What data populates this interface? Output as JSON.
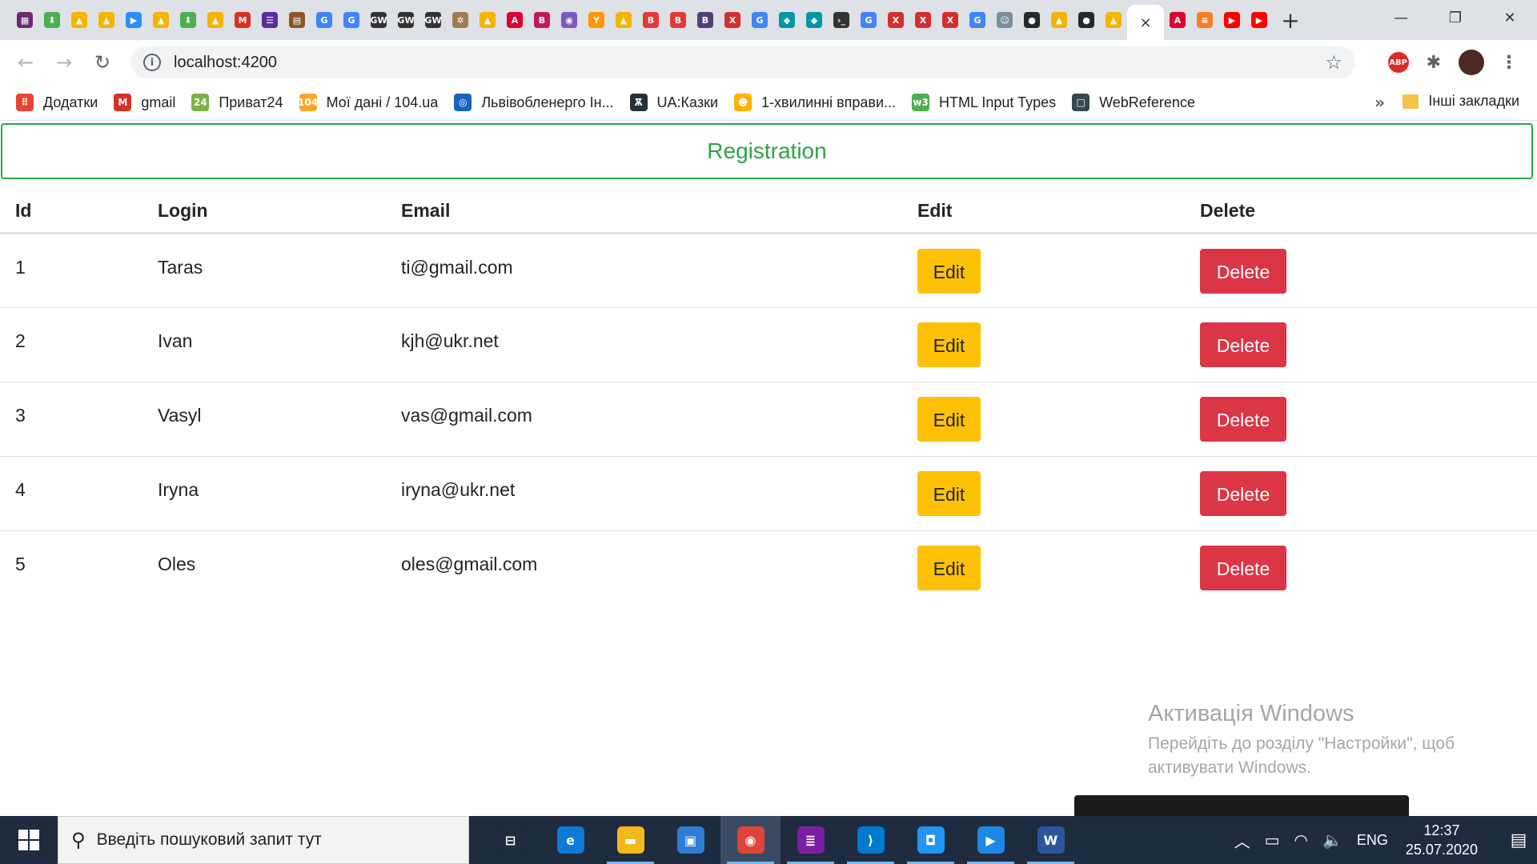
{
  "browser": {
    "tabs": [
      {
        "icon": "calendar-grid-icon",
        "color": "#6a2c70",
        "glyph": "▦"
      },
      {
        "icon": "download-arrow-icon",
        "color": "#4caf50",
        "glyph": "⬇"
      },
      {
        "icon": "google-drive-icon",
        "color": "#f4b400",
        "glyph": "▲"
      },
      {
        "icon": "google-drive-icon",
        "color": "#f4b400",
        "glyph": "▲"
      },
      {
        "icon": "zoom-icon",
        "color": "#2d8cff",
        "glyph": "▶"
      },
      {
        "icon": "google-drive-icon",
        "color": "#f4b400",
        "glyph": "▲"
      },
      {
        "icon": "download-arrow-icon",
        "color": "#4caf50",
        "glyph": "⬇"
      },
      {
        "icon": "google-drive-icon",
        "color": "#f4b400",
        "glyph": "▲"
      },
      {
        "icon": "gmail-icon",
        "color": "#d93025",
        "glyph": "M"
      },
      {
        "icon": "list-icon",
        "color": "#5b2c9a",
        "glyph": "☰"
      },
      {
        "icon": "image-icon",
        "color": "#8d5524",
        "glyph": "▤"
      },
      {
        "icon": "translate-icon",
        "color": "#4285f4",
        "glyph": "G"
      },
      {
        "icon": "translate-icon",
        "color": "#4285f4",
        "glyph": "G"
      },
      {
        "icon": "gw-icon",
        "color": "#333333",
        "glyph": "GW"
      },
      {
        "icon": "gw-icon",
        "color": "#333333",
        "glyph": "GW"
      },
      {
        "icon": "gw-icon",
        "color": "#333333",
        "glyph": "GW"
      },
      {
        "icon": "tree-icon",
        "color": "#9e7b4f",
        "glyph": "✲"
      },
      {
        "icon": "google-drive-icon",
        "color": "#f4b400",
        "glyph": "▲"
      },
      {
        "icon": "angular-icon",
        "color": "#dd0031",
        "glyph": "A"
      },
      {
        "icon": "b-icon",
        "color": "#c2185b",
        "glyph": "B"
      },
      {
        "icon": "eye-icon",
        "color": "#7e57c2",
        "glyph": "◉"
      },
      {
        "icon": "figure-icon",
        "color": "#ff9800",
        "glyph": "Y"
      },
      {
        "icon": "google-drive-icon",
        "color": "#f4b400",
        "glyph": "▲"
      },
      {
        "icon": "b-icon",
        "color": "#e53935",
        "glyph": "B"
      },
      {
        "icon": "b-icon",
        "color": "#e53935",
        "glyph": "B"
      },
      {
        "icon": "bootstrap-icon",
        "color": "#563d7c",
        "glyph": "B"
      },
      {
        "icon": "figure-icon",
        "color": "#d32f2f",
        "glyph": "X"
      },
      {
        "icon": "google-icon",
        "color": "#4285f4",
        "glyph": "G"
      },
      {
        "icon": "bird-icon",
        "color": "#0097a7",
        "glyph": "◆"
      },
      {
        "icon": "bird-icon",
        "color": "#0097a7",
        "glyph": "◆"
      },
      {
        "icon": "terminal-icon",
        "color": "#333333",
        "glyph": "›_"
      },
      {
        "icon": "google-icon",
        "color": "#4285f4",
        "glyph": "G"
      },
      {
        "icon": "figure-icon",
        "color": "#d32f2f",
        "glyph": "X"
      },
      {
        "icon": "figure-icon",
        "color": "#d32f2f",
        "glyph": "X"
      },
      {
        "icon": "figure-icon",
        "color": "#d32f2f",
        "glyph": "X"
      },
      {
        "icon": "google-icon",
        "color": "#4285f4",
        "glyph": "G"
      },
      {
        "icon": "robot-icon",
        "color": "#78909c",
        "glyph": "☺"
      },
      {
        "icon": "github-icon",
        "color": "#24292e",
        "glyph": "●"
      },
      {
        "icon": "google-drive-icon",
        "color": "#f4b400",
        "glyph": "▲"
      },
      {
        "icon": "github-icon",
        "color": "#24292e",
        "glyph": "●"
      },
      {
        "icon": "google-drive-icon",
        "color": "#f4b400",
        "glyph": "▲"
      }
    ],
    "tabs_after": [
      {
        "icon": "angular-icon",
        "color": "#dd0031",
        "glyph": "A"
      },
      {
        "icon": "stackoverflow-icon",
        "color": "#f48024",
        "glyph": "≡"
      },
      {
        "icon": "youtube-icon",
        "color": "#ff0000",
        "glyph": "▶"
      },
      {
        "icon": "youtube-icon",
        "color": "#ff0000",
        "glyph": "▶"
      }
    ],
    "active_tab_close": "×",
    "new_tab": "+",
    "window_controls": {
      "minimize": "—",
      "restore": "❐",
      "close": "✕"
    },
    "nav": {
      "back": "←",
      "forward": "→",
      "reload": "↻"
    },
    "url": "localhost:4200",
    "info_glyph": "i",
    "star": "☆",
    "abp_label": "ABP",
    "extensions_glyph": "✱",
    "menu_glyph": "⋮"
  },
  "bookmarks": {
    "items": [
      {
        "label": "Додатки",
        "icon": "apps-grid-icon",
        "color": "#ea4335",
        "glyph": "⠿"
      },
      {
        "label": "gmail",
        "icon": "gmail-icon",
        "color": "#d93025",
        "glyph": "M"
      },
      {
        "label": "Приват24",
        "icon": "privat24-icon",
        "color": "#7cb342",
        "glyph": "24"
      },
      {
        "label": "Мої дані / 104.ua",
        "icon": "ua104-icon",
        "color": "#f9a825",
        "glyph": "104"
      },
      {
        "label": "Львівобленерго Ін...",
        "icon": "energy-icon",
        "color": "#1565c0",
        "glyph": "◎"
      },
      {
        "label": "UA:Казки",
        "icon": "uakazky-icon",
        "color": "#263238",
        "glyph": "Ѫ"
      },
      {
        "label": "1-хвилинні вправи...",
        "icon": "emoji-icon",
        "color": "#ffb300",
        "glyph": "☻"
      },
      {
        "label": "HTML Input Types",
        "icon": "w3-icon",
        "color": "#4caf50",
        "glyph": "w3"
      },
      {
        "label": "WebReference",
        "icon": "chat-icon",
        "color": "#37474f",
        "glyph": "□"
      }
    ],
    "more": "»",
    "other": "Інші закладки"
  },
  "page": {
    "registration_label": "Registration",
    "table": {
      "headers": {
        "id": "Id",
        "login": "Login",
        "email": "Email",
        "edit": "Edit",
        "delete": "Delete"
      },
      "rows": [
        {
          "id": "1",
          "login": "Taras",
          "email": "ti@gmail.com",
          "edit": "Edit",
          "delete": "Delete"
        },
        {
          "id": "2",
          "login": "Ivan",
          "email": "kjh@ukr.net",
          "edit": "Edit",
          "delete": "Delete"
        },
        {
          "id": "3",
          "login": "Vasyl",
          "email": "vas@gmail.com",
          "edit": "Edit",
          "delete": "Delete"
        },
        {
          "id": "4",
          "login": "Iryna",
          "email": "iryna@ukr.net",
          "edit": "Edit",
          "delete": "Delete"
        },
        {
          "id": "5",
          "login": "Oles",
          "email": "oles@gmail.com",
          "edit": "Edit",
          "delete": "Delete"
        }
      ]
    },
    "colors": {
      "registration": "#28a745",
      "edit": "#ffc107",
      "delete": "#dc3545"
    }
  },
  "watermark": {
    "title": "Активація Windows",
    "line1": "Перейдіть до розділу \"Настройки\", щоб",
    "line2": "активувати Windows."
  },
  "taskbar": {
    "search_placeholder": "Введіть пошуковий запит тут",
    "search_glyph": "⚲",
    "apps": [
      {
        "name": "task-view-icon",
        "color": "#1f2b3f",
        "glyph": "⊟",
        "running": false,
        "active": false
      },
      {
        "name": "edge-icon",
        "color": "#0f7bd7",
        "glyph": "e",
        "running": false,
        "active": false
      },
      {
        "name": "file-explorer-icon",
        "color": "#f2b91d",
        "glyph": "▬",
        "running": true,
        "active": false
      },
      {
        "name": "store-icon",
        "color": "#2d7dd2",
        "glyph": "▣",
        "running": false,
        "active": false
      },
      {
        "name": "chrome-icon",
        "color": "#db4437",
        "glyph": "◉",
        "running": true,
        "active": true
      },
      {
        "name": "winrar-icon",
        "color": "#7b1fa2",
        "glyph": "≣",
        "running": true,
        "active": false
      },
      {
        "name": "vscode-icon",
        "color": "#007acc",
        "glyph": "⟩",
        "running": true,
        "active": false
      },
      {
        "name": "app-icon",
        "color": "#2196f3",
        "glyph": "◘",
        "running": true,
        "active": false
      },
      {
        "name": "video-icon",
        "color": "#1e88e5",
        "glyph": "▶",
        "running": true,
        "active": false
      },
      {
        "name": "word-icon",
        "color": "#2b579a",
        "glyph": "W",
        "running": true,
        "active": false
      }
    ],
    "tray": {
      "chevron": "︿",
      "battery": "▭",
      "wifi": "◠",
      "volume": "🔈",
      "lang": "ENG"
    },
    "time": "12:37",
    "date": "25.07.2020",
    "notifications_glyph": "▤"
  }
}
